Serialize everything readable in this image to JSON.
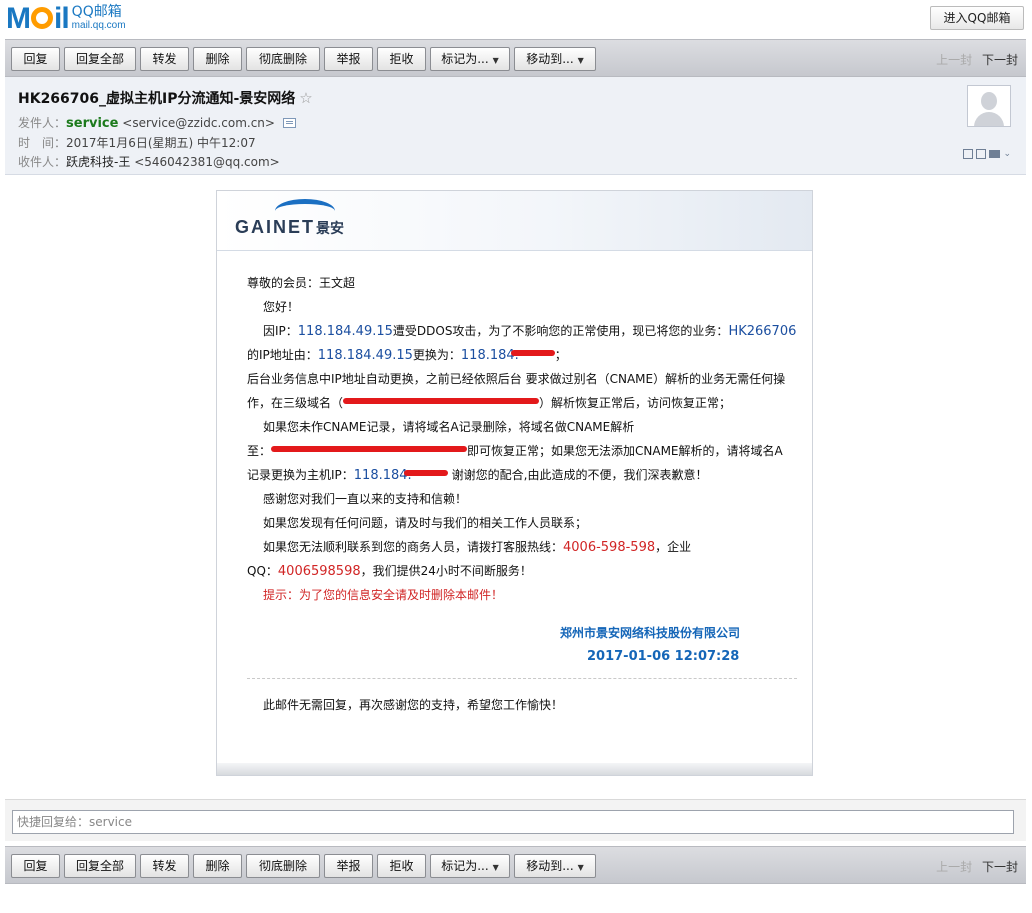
{
  "app": {
    "logo_text": "QQ邮箱",
    "logo_domain": "mail.qq.com",
    "enter_button": "进入QQ邮箱"
  },
  "toolbar": {
    "buttons": [
      "回复",
      "回复全部",
      "转发",
      "删除",
      "彻底删除",
      "举报",
      "拒收"
    ],
    "mark_as": "标记为...",
    "move_to": "移动到...",
    "prev": "上一封",
    "next": "下一封"
  },
  "mail": {
    "subject": "HK266706_虚拟主机IP分流通知-景安网络",
    "from_label": "发件人：",
    "from_name": "service",
    "from_email": "<service@zzidc.com.cn>",
    "time_label": "时　间：",
    "time_value": "2017年1月6日(星期五) 中午12:07",
    "to_label": "收件人：",
    "to_name": "跃虎科技-王",
    "to_email": "<546042381@qq.com>"
  },
  "body": {
    "brand": "GAINET",
    "brand_cn": "景安",
    "greeting": "尊敬的会员：王文超",
    "hello": "您好！",
    "p1_a": "因IP：",
    "ip1": "118.184.49.15",
    "p1_b": "遭受DDOS攻击，为了不影响您的正常使用，现已将您的业务：",
    "service_id": "HK266706",
    "p2_a": "的IP地址由：",
    "ip2": "118.184.49.15",
    "p2_b": "更换为：",
    "ip3_visible": "118.184.",
    "p2_c": "；",
    "p3": "后台业务信息中IP地址自动更换，之前已经依照后台 要求做过别名（CNAME）解析的业务无需任何操",
    "p4_a": "作，在三级域名（",
    "p4_b": "）解析恢复正常后，访问恢复正常；",
    "p5": "如果您未作CNAME记录，请将域名A记录删除，将域名做CNAME解析",
    "p6_a": "至：",
    "p6_b": "即可恢复正常；如果您无法添加CNAME解析的，请将域名A",
    "p7_a": "记录更换为主机IP：",
    "ip4_visible": "118.184.",
    "p7_b": "谢谢您的配合,由此造成的不便，我们深表歉意！",
    "p8": "感谢您对我们一直以来的支持和信赖！",
    "p9": "如果您发现有任何问题，请及时与我们的相关工作人员联系；",
    "p10_a": "如果您无法顺利联系到您的商务人员，请拨打客服热线：",
    "hotline": "4006-598-598",
    "p10_b": "，企业",
    "p11_a": "QQ：",
    "qq": "4006598598",
    "p11_b": "，我们提供24小时不间断服务！",
    "tip": "提示：为了您的信息安全请及时删除本邮件！",
    "company": "郑州市景安网络科技股份有限公司",
    "sign_date": "2017-01-06 12:07:28",
    "noreply": "此邮件无需回复，再次感谢您的支持，希望您工作愉快！"
  },
  "quick_reply": {
    "placeholder": "快捷回复给：service"
  },
  "colors": {
    "accent_blue": "#1a78c2",
    "ip_blue": "#1c4fa0",
    "hotline_red": "#d12525",
    "sender_green": "#1c7a1c",
    "redaction_red": "#e3191b"
  }
}
